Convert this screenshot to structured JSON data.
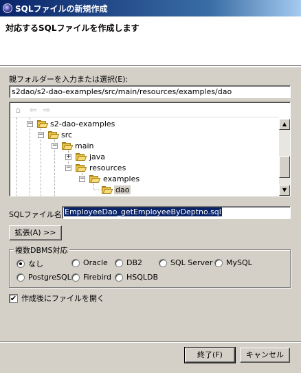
{
  "window": {
    "title": "SQLファイルの新規作成",
    "app_icon": "eclipse-icon"
  },
  "header": {
    "description": "対応するSQLファイルを作成します"
  },
  "parent_folder": {
    "label": "親フォルダーを入力または選択(E):",
    "value": "s2dao/s2-dao-examples/src/main/resources/examples/dao"
  },
  "tree": {
    "toolbar": [
      "home-icon",
      "back-arrow-icon",
      "forward-arrow-icon"
    ],
    "nodes": [
      {
        "label": "s2-dao-examples",
        "expander": "−"
      },
      {
        "label": "src",
        "expander": "−"
      },
      {
        "label": "main",
        "expander": "−"
      },
      {
        "label": "java",
        "expander": "+"
      },
      {
        "label": "resources",
        "expander": "−"
      },
      {
        "label": "examples",
        "expander": "−"
      },
      {
        "label": "dao",
        "expander": ""
      }
    ],
    "scroll_up": "▲",
    "scroll_down": "▼"
  },
  "sql_file": {
    "label": "SQLファイル名:",
    "value": "EmployeeDao_getEmployeeByDeptno.sql"
  },
  "expand_button": "拡張(A) >>",
  "dbms_group": {
    "title": "複数DBMS対応",
    "options": [
      "なし",
      "Oracle",
      "DB2",
      "SQL Server",
      "MySQL",
      "PostgreSQL",
      "Firebird",
      "HSQLDB"
    ],
    "selected": "なし"
  },
  "open_after": {
    "label": "作成後にファイルを開く",
    "checked": true,
    "check_mark": "✔"
  },
  "buttons": {
    "finish": "終了(F)",
    "cancel": "キャンセル"
  },
  "colors": {
    "titlebar_start": "#0a246a",
    "titlebar_end": "#a6caf0",
    "dialog_bg": "#d4d0c8",
    "selection": "#0a246a"
  }
}
